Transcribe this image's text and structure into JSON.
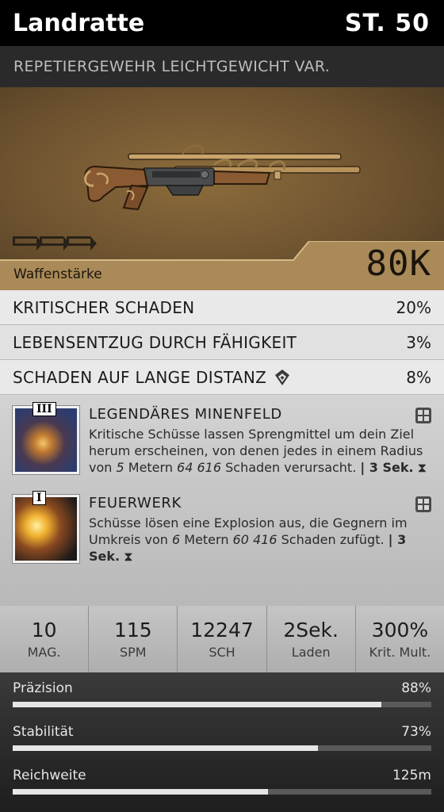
{
  "header": {
    "title": "Landratte",
    "level": "ST. 50"
  },
  "subtitle": "REPETIERGEWEHR LEICHTGEWICHT VAR.",
  "weapon": {
    "power_label": "Waffenstärke",
    "power_value": "80K",
    "image": "bolt-action-rifle"
  },
  "attributes": [
    {
      "name": "KRITISCHER SCHADEN",
      "value": "20%"
    },
    {
      "name": "LEBENSENTZUG DURCH FÄHIGKEIT",
      "value": "3%"
    },
    {
      "name": "SCHADEN AUF LANGE DISTANZ",
      "value": "8%",
      "icon": "shield-chevron-icon"
    }
  ],
  "talents": [
    {
      "rank": "III",
      "name": "LEGENDÄRES MINENFELD",
      "desc_a": "Kritische Schüsse lassen Sprengmittel um dein Ziel herum erscheinen, von denen jedes in einem Radius von ",
      "desc_em1": "5",
      "desc_b": " Metern ",
      "desc_em2": "64 616",
      "desc_c": " Schaden verursacht. ",
      "cooldown": "| 3 Sek."
    },
    {
      "rank": "I",
      "name": "FEUERWERK",
      "desc_a": "Schüsse lösen eine Explosion aus, die Gegnern im Umkreis von ",
      "desc_em1": "6",
      "desc_b": " Metern ",
      "desc_em2": "60 416",
      "desc_c": " Schaden zufügt. ",
      "cooldown": "| 3 Sek."
    }
  ],
  "stats": [
    {
      "value": "10",
      "label": "MAG."
    },
    {
      "value": "115",
      "label": "SPM"
    },
    {
      "value": "12247",
      "label": "SCH"
    },
    {
      "value": "2Sek.",
      "label": "Laden"
    },
    {
      "value": "300%",
      "label": "Krit. Mult."
    }
  ],
  "bars": [
    {
      "label": "Präzision",
      "value": "88%",
      "fill": 0.88
    },
    {
      "label": "Stabilität",
      "value": "73%",
      "fill": 0.73
    },
    {
      "label": "Reichweite",
      "value": "125m",
      "fill": 0.61
    }
  ]
}
